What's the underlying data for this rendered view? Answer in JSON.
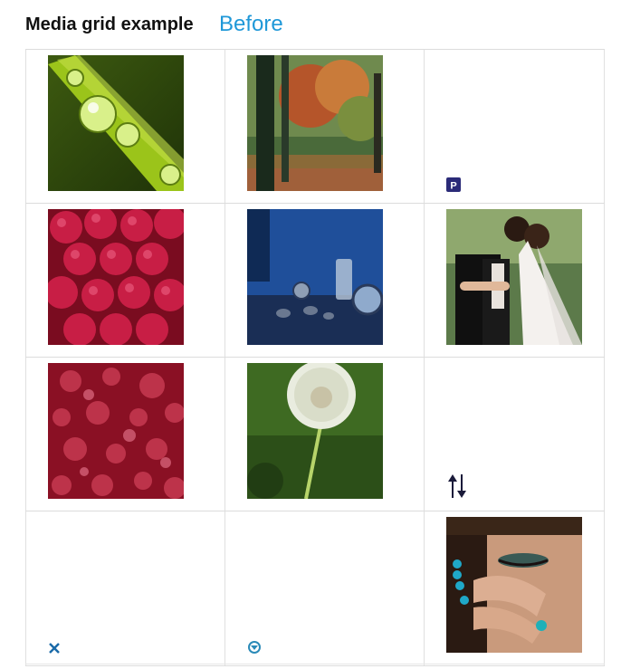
{
  "header": {
    "title": "Media grid example",
    "before_link": "Before"
  },
  "grid": {
    "items": [
      {
        "kind": "image",
        "name": "water-drops-leaf-image"
      },
      {
        "kind": "image",
        "name": "autumn-park-trees-image"
      },
      {
        "kind": "file-icon",
        "name": "powerpoint-file-icon"
      },
      {
        "kind": "image",
        "name": "raspberries-image"
      },
      {
        "kind": "image",
        "name": "blue-clocks-still-life-image"
      },
      {
        "kind": "image",
        "name": "wedding-couple-image"
      },
      {
        "kind": "image",
        "name": "red-bokeh-image"
      },
      {
        "kind": "image",
        "name": "dandelion-image"
      },
      {
        "kind": "file-icon",
        "name": "sort-arrows-icon"
      },
      {
        "kind": "file-icon",
        "name": "close-x-icon"
      },
      {
        "kind": "file-icon",
        "name": "download-circle-icon"
      },
      {
        "kind": "image",
        "name": "woman-face-closeup-image"
      }
    ]
  },
  "colors": {
    "link": "#1f98d8",
    "border": "#dcdcdc"
  }
}
